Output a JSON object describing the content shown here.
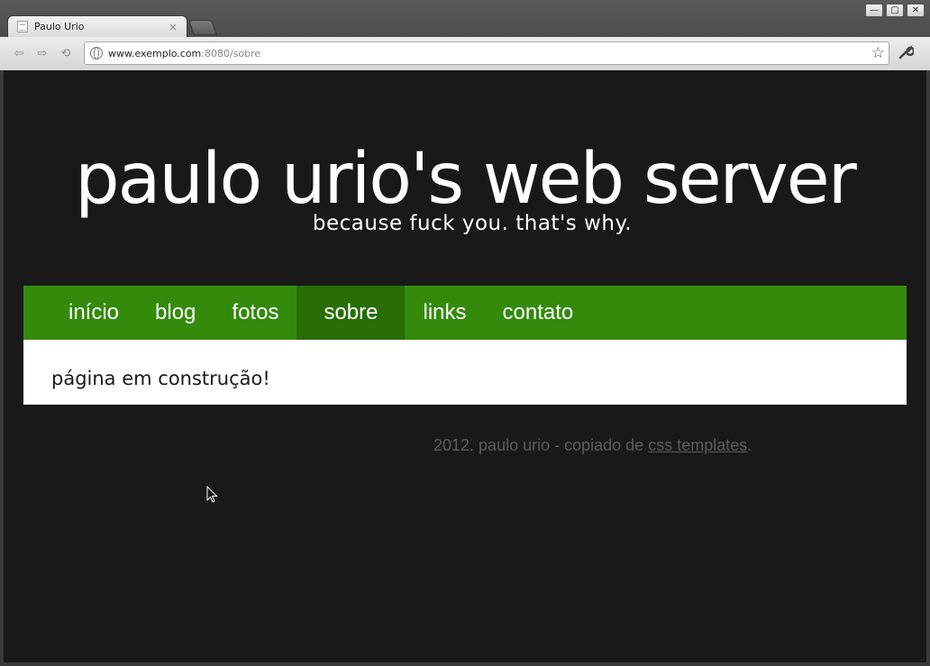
{
  "browser": {
    "tab_title": "Paulo Urio",
    "tab_close": "×",
    "url_host": "www.exemplo.com",
    "url_rest": ":8080/sobre",
    "window_buttons": {
      "minimize": "—",
      "maximize": "▢",
      "close": "✕"
    },
    "nav": {
      "back": "⇦",
      "forward": "⇨",
      "reload": "⟲"
    },
    "star": "☆",
    "wrench": "🔧"
  },
  "site": {
    "title": "paulo urio's web server",
    "tagline": "because fuck you. that's why.",
    "menu": [
      {
        "label": "início",
        "active": false
      },
      {
        "label": "blog",
        "active": false
      },
      {
        "label": "fotos",
        "active": false
      },
      {
        "label": "sobre",
        "active": true
      },
      {
        "label": "links",
        "active": false
      },
      {
        "label": "contato",
        "active": false
      }
    ],
    "content_text": "página em construção!",
    "footer": {
      "prefix": "2012. paulo urio - copiado de ",
      "link": "css templates",
      "suffix": "."
    }
  },
  "colors": {
    "page_bg": "#191919",
    "menu_bg": "#348a0b",
    "menu_active_bg": "#286d06",
    "footer_text": "#5c5c5c"
  }
}
